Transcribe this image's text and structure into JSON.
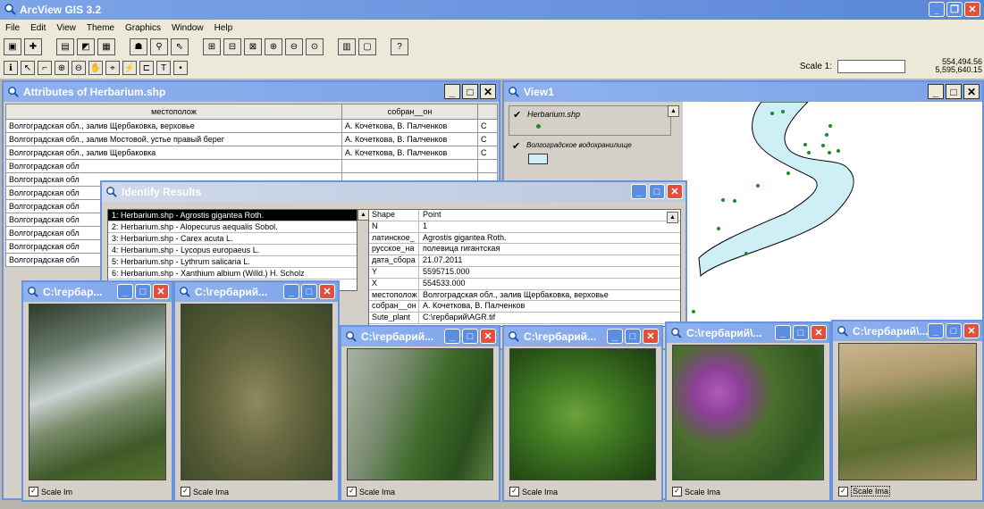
{
  "app": {
    "title": "ArcView GIS 3.2"
  },
  "menu": [
    "File",
    "Edit",
    "View",
    "Theme",
    "Graphics",
    "Window",
    "Help"
  ],
  "scale": {
    "label": "Scale 1:",
    "value": "",
    "coords_1": "554,494.56",
    "coords_2": "5,595,640.15"
  },
  "attributes": {
    "title": "Attributes of Herbarium.shp",
    "columns": [
      "местополож",
      "собран__он"
    ],
    "rows": [
      [
        "Волгоградская обл., залив Щербаковка, верховье",
        "А. Кочеткова, В. Палченков",
        "С"
      ],
      [
        "Волгоградская обл., залив Мостовой, устье правый берег",
        "А. Кочеткова, В. Палченков",
        "С"
      ],
      [
        "Волгоградская обл., залив Щербаковка",
        "А. Кочеткова, В. Палченков",
        "С"
      ],
      [
        "Волгоградская обл",
        "",
        ""
      ],
      [
        "Волгоградская обл",
        "",
        ""
      ],
      [
        "Волгоградская обл",
        "",
        ""
      ],
      [
        "Волгоградская обл",
        "",
        ""
      ],
      [
        "Волгоградская обл",
        "",
        ""
      ],
      [
        "Волгоградская обл",
        "",
        ""
      ],
      [
        "Волгоградская обл",
        "",
        ""
      ],
      [
        "Волгоградская обл",
        "",
        ""
      ]
    ]
  },
  "identify": {
    "title": "Identify Results",
    "items": [
      "1: Herbarium.shp - Agrostis gigantea Roth.",
      "2: Herbarium.shp - Alopecurus aequalis Sobol.",
      "3: Herbarium.shp - Carex acuta L.",
      "4: Herbarium.shp - Lycopus europaeus L.",
      "5: Herbarium.shp - Lythrum salicaria L.",
      "6: Herbarium.shp - Xanthium albium (Willd.) H. Scholz"
    ],
    "fields": [
      {
        "k": "Shape",
        "v": "Point"
      },
      {
        "k": "N",
        "v": "1"
      },
      {
        "k": "латинское_",
        "v": "Agrostis gigantea Roth."
      },
      {
        "k": "русское_на",
        "v": "полевица гигантская"
      },
      {
        "k": "дата_сбора",
        "v": "21.07.2011"
      },
      {
        "k": "Y",
        "v": "5595715.000"
      },
      {
        "k": "X",
        "v": "554533.000"
      },
      {
        "k": "местополож",
        "v": "Волгоградская обл., залив Щербаковка, верховье"
      },
      {
        "k": "собран__он",
        "v": "А. Кочеткова, В. Палченков"
      },
      {
        "k": "Sute_plant",
        "v": "C:\\гербарий\\AGR.tif"
      }
    ]
  },
  "view": {
    "title": "View1",
    "legend": [
      "Herbarium.shp",
      "Волгоградское водохранилище"
    ]
  },
  "photos": [
    {
      "title": "C:\\гербар...",
      "scale": "Scale Im"
    },
    {
      "title": "C:\\гербарий...",
      "scale": "Scale Ima"
    },
    {
      "title": "C:\\гербарий...",
      "scale": "Scale Ima"
    },
    {
      "title": "C:\\гербарий...",
      "scale": "Scale Ima"
    },
    {
      "title": "C:\\гербарий\\...",
      "scale": "Scale Ima"
    },
    {
      "title": "C:\\гербарий\\...",
      "scale": "Scale Ima"
    }
  ]
}
